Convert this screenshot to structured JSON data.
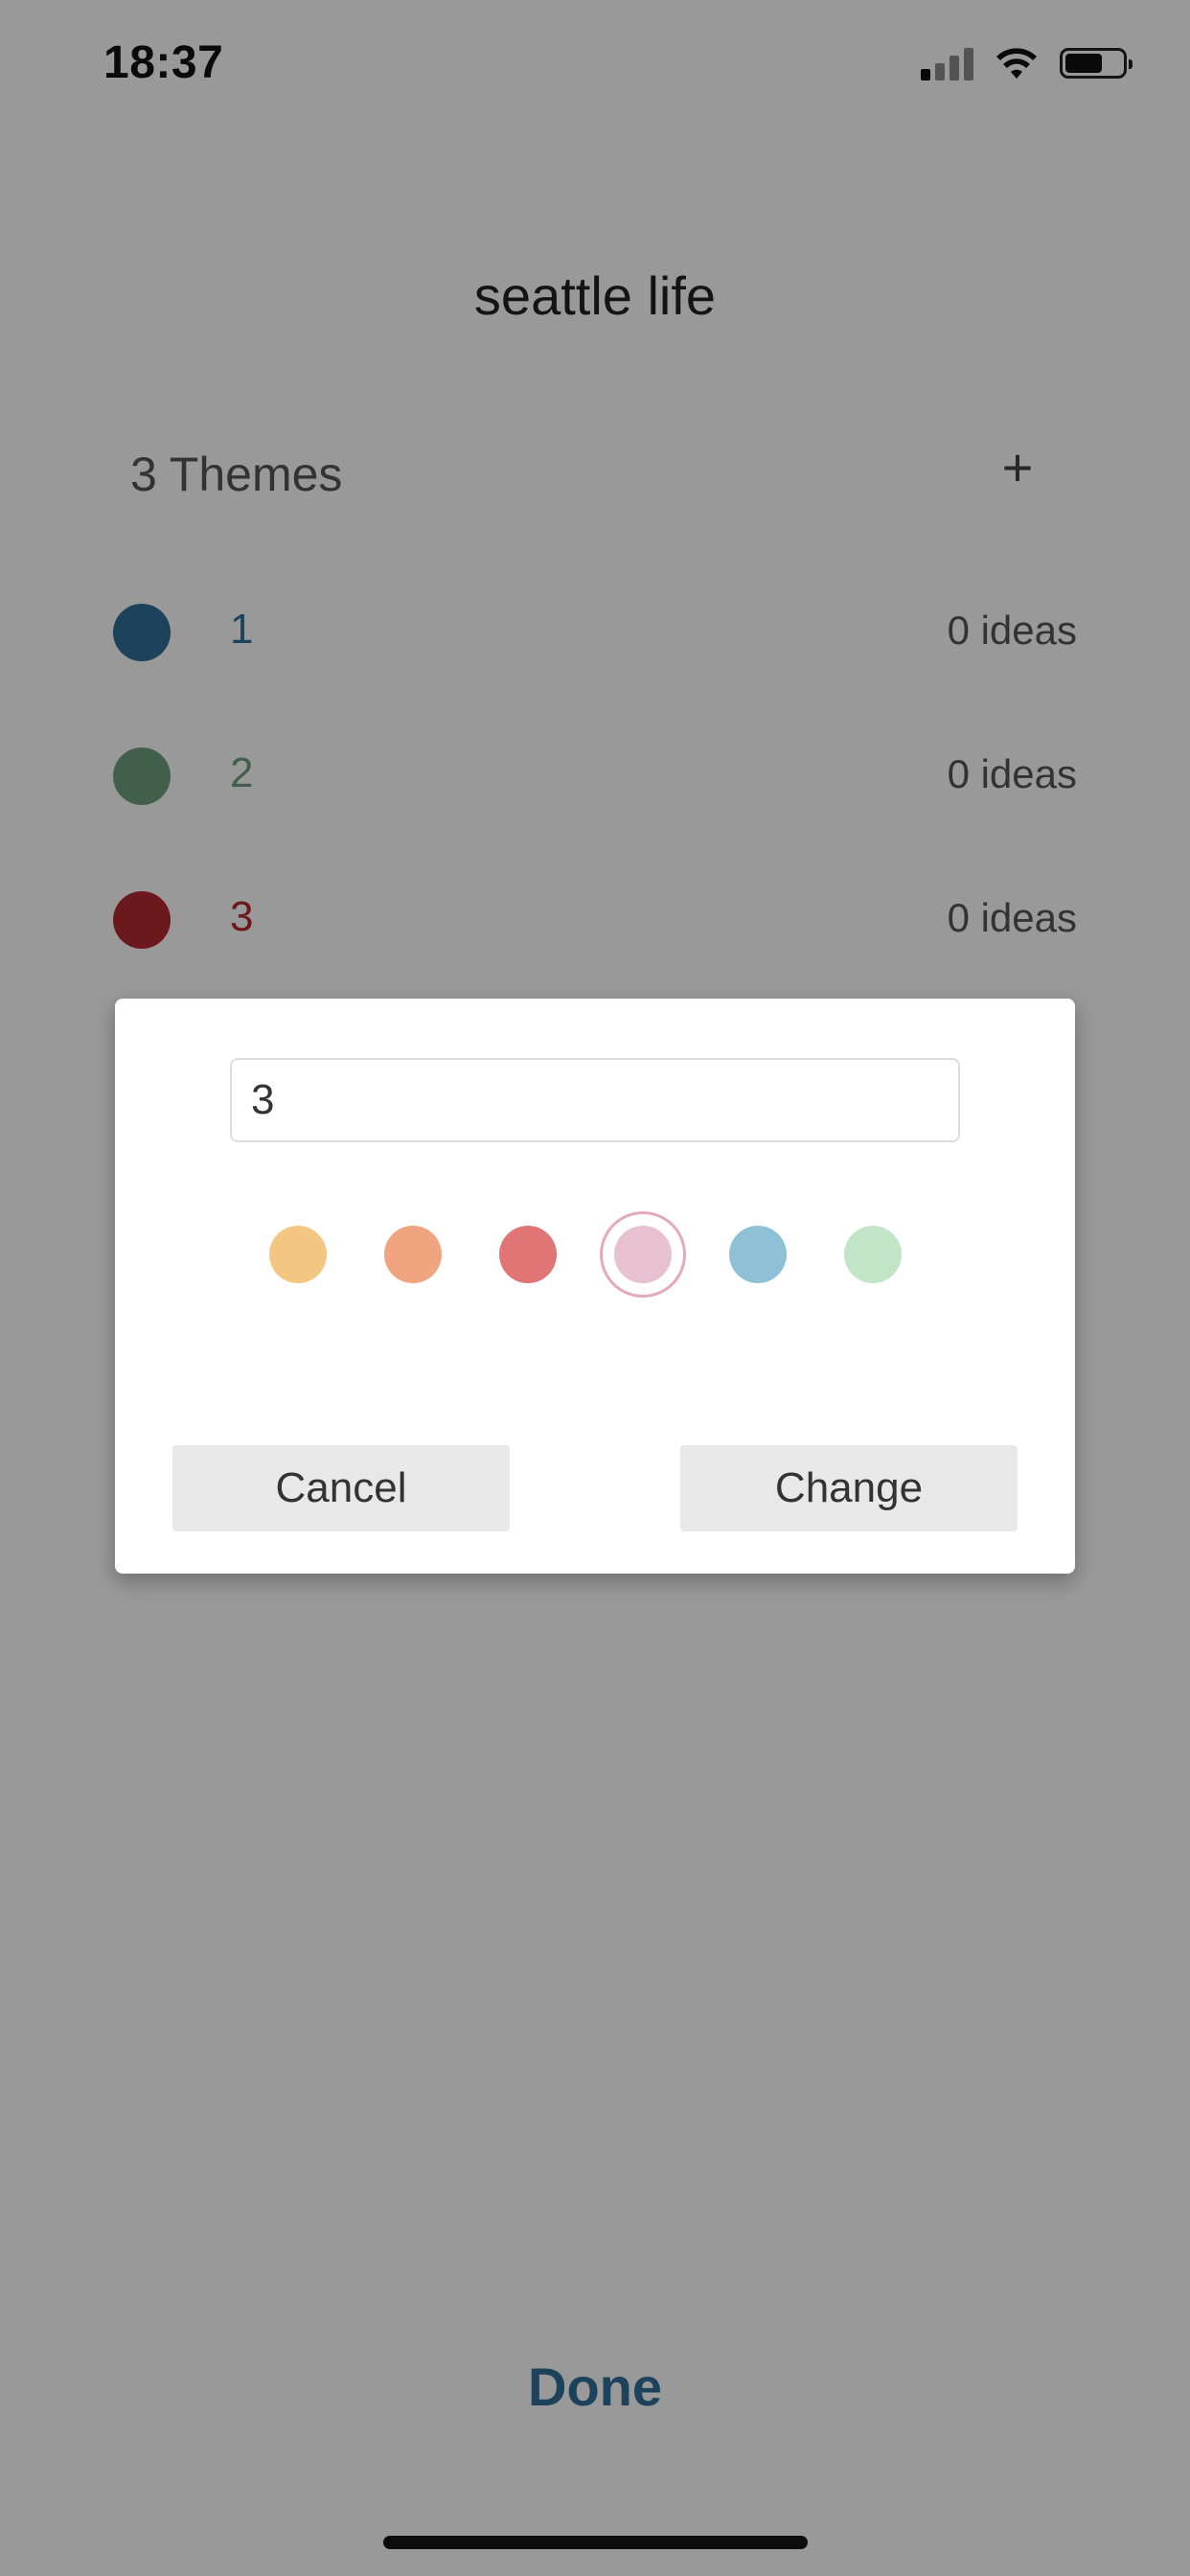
{
  "status_bar": {
    "time": "18:37"
  },
  "header": {
    "title": "seattle life"
  },
  "themes": {
    "header": "3 Themes",
    "add_label": "+",
    "items": [
      {
        "name": "1",
        "count": "0 ideas",
        "color": "#2f6f9a"
      },
      {
        "name": "2",
        "count": "0 ideas",
        "color": "#6f9f7f"
      },
      {
        "name": "3",
        "count": "0 ideas",
        "color": "#b22a2f"
      }
    ]
  },
  "dialog": {
    "input_value": "3",
    "colors": [
      {
        "name": "yellow",
        "hex": "#f3c682",
        "selected": false
      },
      {
        "name": "orange",
        "hex": "#f0a47f",
        "selected": false
      },
      {
        "name": "red",
        "hex": "#e17575",
        "selected": false
      },
      {
        "name": "pink",
        "hex": "#e8c1d0",
        "selected": true
      },
      {
        "name": "blue",
        "hex": "#8fc1d6",
        "selected": false
      },
      {
        "name": "green",
        "hex": "#c2e5c8",
        "selected": false
      }
    ],
    "cancel_label": "Cancel",
    "change_label": "Change"
  },
  "footer": {
    "done_label": "Done"
  },
  "colors": {
    "overlay": "rgba(0,0,0,0.40)",
    "accent": "#2f6f9a"
  }
}
